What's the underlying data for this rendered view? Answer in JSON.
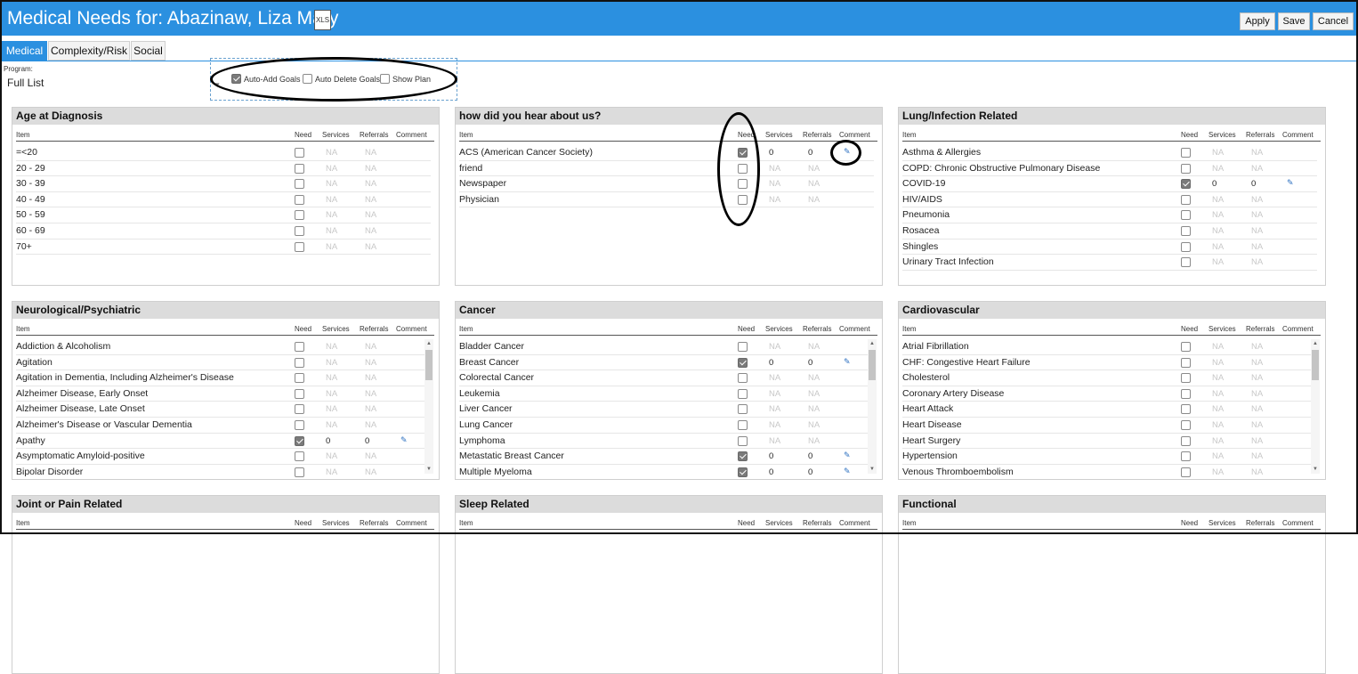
{
  "header": {
    "title": "Medical Needs for: Abazinaw, Liza Mary",
    "xls_label": "XLS",
    "apply_label": "Apply",
    "save_label": "Save",
    "cancel_label": "Cancel",
    "color": "#2b90e0"
  },
  "tabs": [
    {
      "label": "Medical",
      "active": true
    },
    {
      "label": "Complexity/Risk",
      "active": false
    },
    {
      "label": "Social",
      "active": false
    }
  ],
  "program": {
    "label": "Program:",
    "value": "Full List"
  },
  "options": [
    {
      "label": "Auto-Add Goals",
      "checked": true
    },
    {
      "label": "Auto Delete Goals",
      "checked": false
    },
    {
      "label": "Show Plan",
      "checked": false
    }
  ],
  "columns": {
    "item": "Item",
    "need": "Need",
    "services": "Services",
    "referrals": "Referrals",
    "comment": "Comment"
  },
  "panels": [
    {
      "title": "Age at Diagnosis",
      "scroll": false,
      "rows": [
        {
          "item": "=<20",
          "need": false,
          "services": "NA",
          "referrals": "NA"
        },
        {
          "item": "20 - 29",
          "need": false,
          "services": "NA",
          "referrals": "NA"
        },
        {
          "item": "30 - 39",
          "need": false,
          "services": "NA",
          "referrals": "NA"
        },
        {
          "item": "40 - 49",
          "need": false,
          "services": "NA",
          "referrals": "NA"
        },
        {
          "item": "50 - 59",
          "need": false,
          "services": "NA",
          "referrals": "NA"
        },
        {
          "item": "60 - 69",
          "need": false,
          "services": "NA",
          "referrals": "NA"
        },
        {
          "item": "70+",
          "need": false,
          "services": "NA",
          "referrals": "NA"
        }
      ]
    },
    {
      "title": "how did you hear about us?",
      "scroll": false,
      "rows": [
        {
          "item": "ACS (American Cancer Society)",
          "need": true,
          "services": "0",
          "referrals": "0",
          "comment": true
        },
        {
          "item": "friend",
          "need": false,
          "services": "NA",
          "referrals": "NA"
        },
        {
          "item": "Newspaper",
          "need": false,
          "services": "NA",
          "referrals": "NA"
        },
        {
          "item": "Physician",
          "need": false,
          "services": "NA",
          "referrals": "NA"
        }
      ]
    },
    {
      "title": "Lung/Infection Related",
      "scroll": false,
      "rows": [
        {
          "item": "Asthma & Allergies",
          "need": false,
          "services": "NA",
          "referrals": "NA"
        },
        {
          "item": "COPD: Chronic Obstructive Pulmonary Disease",
          "need": false,
          "services": "NA",
          "referrals": "NA"
        },
        {
          "item": "COVID-19",
          "need": true,
          "services": "0",
          "referrals": "0",
          "comment": true
        },
        {
          "item": "HIV/AIDS",
          "need": false,
          "services": "NA",
          "referrals": "NA"
        },
        {
          "item": "Pneumonia",
          "need": false,
          "services": "NA",
          "referrals": "NA"
        },
        {
          "item": "Rosacea",
          "need": false,
          "services": "NA",
          "referrals": "NA"
        },
        {
          "item": "Shingles",
          "need": false,
          "services": "NA",
          "referrals": "NA"
        },
        {
          "item": "Urinary Tract Infection",
          "need": false,
          "services": "NA",
          "referrals": "NA"
        }
      ]
    },
    {
      "title": "Neurological/Psychiatric",
      "scroll": true,
      "rows": [
        {
          "item": "Addiction & Alcoholism",
          "need": false,
          "services": "NA",
          "referrals": "NA"
        },
        {
          "item": "Agitation",
          "need": false,
          "services": "NA",
          "referrals": "NA"
        },
        {
          "item": "Agitation in Dementia, Including Alzheimer's Disease",
          "need": false,
          "services": "NA",
          "referrals": "NA"
        },
        {
          "item": "Alzheimer Disease, Early Onset",
          "need": false,
          "services": "NA",
          "referrals": "NA"
        },
        {
          "item": "Alzheimer Disease, Late Onset",
          "need": false,
          "services": "NA",
          "referrals": "NA"
        },
        {
          "item": "Alzheimer's Disease or Vascular Dementia",
          "need": false,
          "services": "NA",
          "referrals": "NA"
        },
        {
          "item": "Apathy",
          "need": true,
          "services": "0",
          "referrals": "0",
          "comment": true
        },
        {
          "item": "Asymptomatic Amyloid-positive",
          "need": false,
          "services": "NA",
          "referrals": "NA"
        },
        {
          "item": "Bipolar Disorder",
          "need": false,
          "services": "NA",
          "referrals": "NA"
        }
      ]
    },
    {
      "title": "Cancer",
      "scroll": true,
      "rows": [
        {
          "item": "Bladder Cancer",
          "need": false,
          "services": "NA",
          "referrals": "NA"
        },
        {
          "item": "Breast Cancer",
          "need": true,
          "services": "0",
          "referrals": "0",
          "comment": true
        },
        {
          "item": "Colorectal Cancer",
          "need": false,
          "services": "NA",
          "referrals": "NA"
        },
        {
          "item": "Leukemia",
          "need": false,
          "services": "NA",
          "referrals": "NA"
        },
        {
          "item": "Liver Cancer",
          "need": false,
          "services": "NA",
          "referrals": "NA"
        },
        {
          "item": "Lung Cancer",
          "need": false,
          "services": "NA",
          "referrals": "NA"
        },
        {
          "item": "Lymphoma",
          "need": false,
          "services": "NA",
          "referrals": "NA"
        },
        {
          "item": "Metastatic Breast Cancer",
          "need": true,
          "services": "0",
          "referrals": "0",
          "comment": true
        },
        {
          "item": "Multiple Myeloma",
          "need": true,
          "services": "0",
          "referrals": "0",
          "comment": true
        }
      ]
    },
    {
      "title": "Cardiovascular",
      "scroll": true,
      "rows": [
        {
          "item": "Atrial Fibrillation",
          "need": false,
          "services": "NA",
          "referrals": "NA"
        },
        {
          "item": "CHF: Congestive Heart Failure",
          "need": false,
          "services": "NA",
          "referrals": "NA"
        },
        {
          "item": "Cholesterol",
          "need": false,
          "services": "NA",
          "referrals": "NA"
        },
        {
          "item": "Coronary Artery Disease",
          "need": false,
          "services": "NA",
          "referrals": "NA"
        },
        {
          "item": "Heart Attack",
          "need": false,
          "services": "NA",
          "referrals": "NA"
        },
        {
          "item": "Heart Disease",
          "need": false,
          "services": "NA",
          "referrals": "NA"
        },
        {
          "item": "Heart Surgery",
          "need": false,
          "services": "NA",
          "referrals": "NA"
        },
        {
          "item": "Hypertension",
          "need": false,
          "services": "NA",
          "referrals": "NA"
        },
        {
          "item": "Venous Thromboembolism",
          "need": false,
          "services": "NA",
          "referrals": "NA"
        }
      ]
    },
    {
      "title": "Joint or Pain Related",
      "scroll": false,
      "rows": []
    },
    {
      "title": "Sleep Related",
      "scroll": false,
      "rows": []
    },
    {
      "title": "Functional",
      "scroll": false,
      "rows": []
    }
  ]
}
